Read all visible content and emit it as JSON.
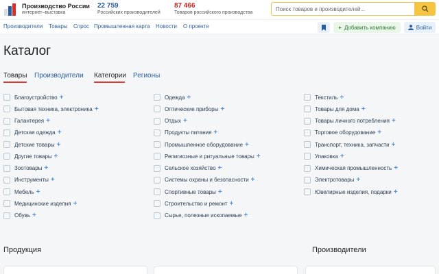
{
  "header": {
    "logo_title": "Производство России",
    "logo_subtitle": "интернет–выставка",
    "stats": [
      {
        "value": "22 759",
        "label": "Российских производителей",
        "color": "#2a5d9f"
      },
      {
        "value": "87 466",
        "label": "Товаров российского производства",
        "color": "#c62828"
      }
    ],
    "search_placeholder": "Поиск товаров и производителей..."
  },
  "nav": {
    "links": [
      "Производители",
      "Товары",
      "Спрос",
      "Промышленная карта",
      "Новости",
      "О проекте"
    ],
    "add_company": "Добавить компанию",
    "login": "Войти"
  },
  "page_title": "Каталог",
  "tabs_left": [
    "Товары",
    "Производители"
  ],
  "tabs_right": [
    "Категории",
    "Регионы"
  ],
  "categories": [
    [
      "Благоустройство",
      "Бытовая техника, электроника",
      "Галантерея",
      "Детская одежда",
      "Детские товары",
      "Другие товары",
      "Зоотовары",
      "Инструменты",
      "Мебель",
      "Медицинские изделия",
      "Обувь"
    ],
    [
      "Одежда",
      "Оптические приборы",
      "Отдых",
      "Продукты питания",
      "Промышленное оборудование",
      "Религиозные и ритуальные товары",
      "Сельское хозяйство",
      "Системы охраны и безопасности",
      "Спортивные товары",
      "Строительство и ремонт",
      "Сырье, полезные ископаемые"
    ],
    [
      "Текстиль",
      "Товары для дома",
      "Товары личного потребления",
      "Торговое оборудование",
      "Транспорт, техника, запчасти",
      "Упаковка",
      "Химическая промышленность",
      "Электротовары",
      "Ювелирные изделия, подарки"
    ]
  ],
  "sections": {
    "products": "Продукция",
    "manufacturers": "Производители"
  },
  "colors": {
    "accent": "#2a5d9f",
    "search": "#f5c542",
    "tab_underline": "#e53935",
    "flag": [
      "#ffffff",
      "#2a5d9f",
      "#d32f2f"
    ]
  }
}
